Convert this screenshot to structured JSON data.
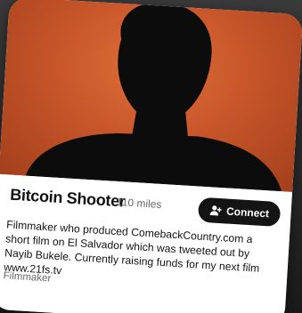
{
  "profile": {
    "name": "Bitcoin Shooter",
    "distance": "110 miles",
    "bio": "Filmmaker who produced ComebackCountry.com a short film on El Salvador which was tweeted out by Nayib Bukele. Currently raising funds for my next film www.21fs.tv",
    "role": "Filmmaker"
  },
  "actions": {
    "connect_label": "Connect",
    "connect_icon": "add-person-icon"
  },
  "colors": {
    "photo_background": "#c8562a",
    "connect_button": "#141414",
    "card": "#ffffff"
  }
}
